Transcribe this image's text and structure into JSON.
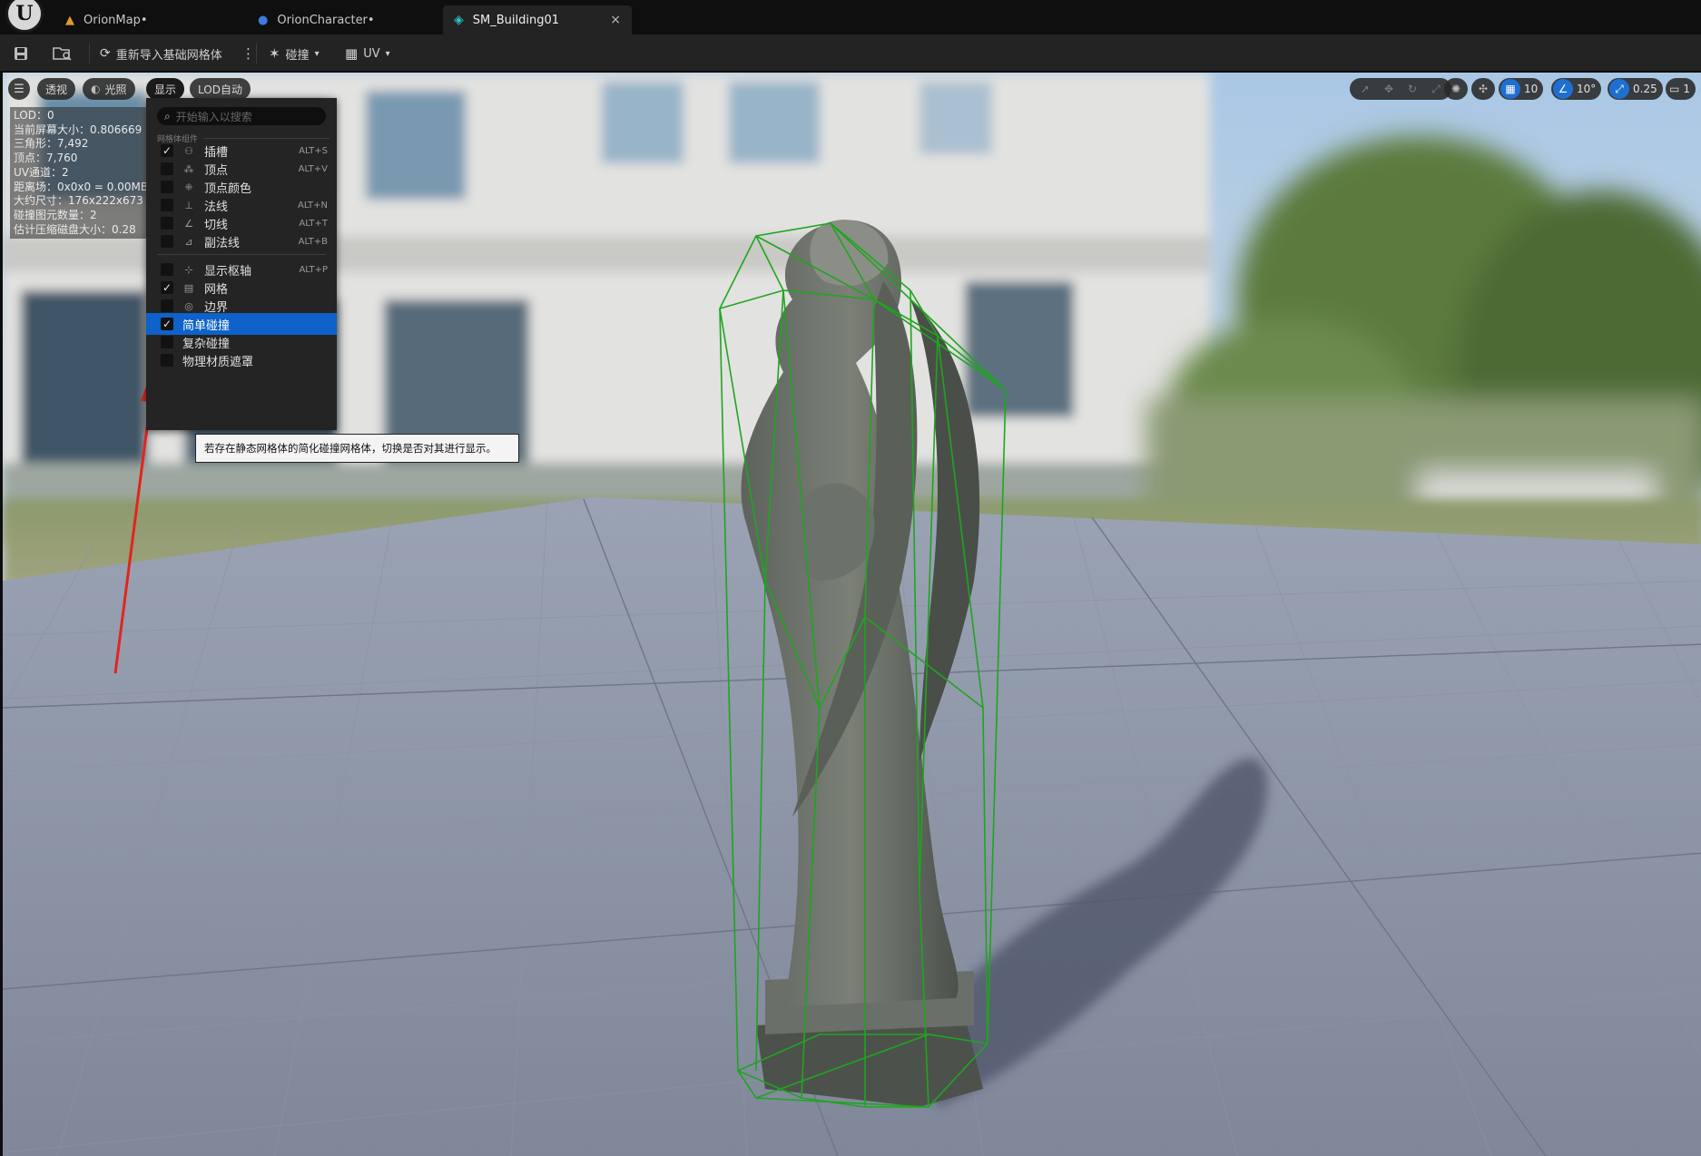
{
  "tabs": [
    {
      "label": "OrionMap•"
    },
    {
      "label": "OrionCharacter•"
    },
    {
      "label": "SM_Building01",
      "close": "×"
    }
  ],
  "toolbar": {
    "reimport_label": "重新导入基础网格体",
    "collision_label": "碰撞",
    "uv_label": "UV"
  },
  "viewport_controls": {
    "perspective": "透视",
    "lit": "光照",
    "show": "显示",
    "lod": "LOD自动"
  },
  "stats": [
    "LOD：0",
    "当前屏幕大小：0.806669",
    "三角形：7,492",
    "顶点：7,760",
    "UV通道：2",
    "距离场：0x0x0 = 0.00MB",
    "大约尺寸：176x222x673",
    "碰撞图元数量：2",
    "估计压缩磁盘大小：0.28"
  ],
  "show_menu": {
    "search_placeholder": "开始输入以搜索",
    "section_title": "网格体组件",
    "items": [
      {
        "label": "插槽",
        "shortcut": "ALT+S",
        "checked": true,
        "icon": "socket-icon"
      },
      {
        "label": "顶点",
        "shortcut": "ALT+V",
        "checked": false,
        "icon": "vertex-icon"
      },
      {
        "label": "顶点颜色",
        "shortcut": "",
        "checked": false,
        "icon": "vertex-color-icon"
      },
      {
        "label": "法线",
        "shortcut": "ALT+N",
        "checked": false,
        "icon": "normal-icon"
      },
      {
        "label": "切线",
        "shortcut": "ALT+T",
        "checked": false,
        "icon": "tangent-icon"
      },
      {
        "label": "副法线",
        "shortcut": "ALT+B",
        "checked": false,
        "icon": "binormal-icon"
      },
      {
        "label": "显示枢轴",
        "shortcut": "ALT+P",
        "checked": false,
        "icon": "pivot-icon"
      },
      {
        "label": "网格",
        "shortcut": "",
        "checked": true,
        "icon": "grid-icon"
      },
      {
        "label": "边界",
        "shortcut": "",
        "checked": false,
        "icon": "bounds-icon"
      },
      {
        "label": "简单碰撞",
        "shortcut": "",
        "checked": true,
        "highlighted": true
      },
      {
        "label": "复杂碰撞",
        "shortcut": "",
        "checked": false
      },
      {
        "label": "物理材质遮罩",
        "shortcut": "",
        "checked": false
      }
    ],
    "tooltip": "若存在静态网格体的简化碰撞网格体，切换是否对其进行显示。"
  },
  "viewport_right": {
    "grid_snap": "10",
    "rotation_snap": "10°",
    "scale_snap": "0.25",
    "camera_speed": "1"
  },
  "colors": {
    "accent_blue": "#0e62c9",
    "collision_green": "#1fa51f",
    "annotation_red": "#e2241f"
  }
}
